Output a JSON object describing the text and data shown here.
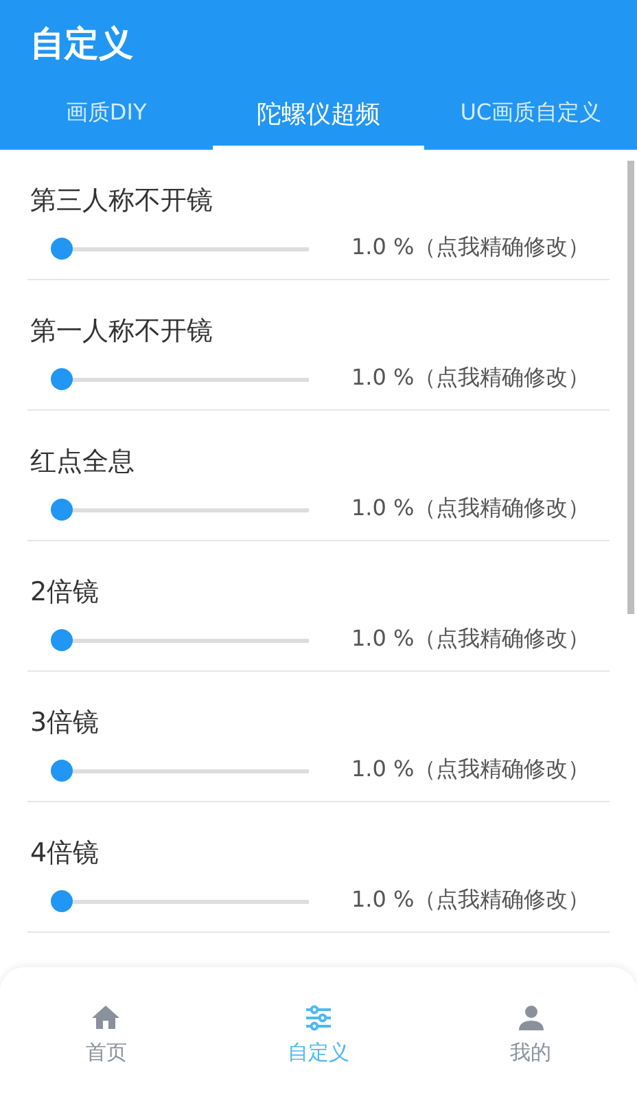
{
  "app_bar": {
    "title": "自定义"
  },
  "tabs": [
    {
      "label": "画质DIY",
      "selected": false
    },
    {
      "label": "陀螺仪超频",
      "selected": true
    },
    {
      "label": "UC画质自定义",
      "selected": false
    }
  ],
  "settings": [
    {
      "name": "第三人称不开镜",
      "level": 0.01,
      "reading": "1.0 %（点我精确修改）"
    },
    {
      "name": "第一人称不开镜",
      "level": 0.01,
      "reading": "1.0 %（点我精确修改）"
    },
    {
      "name": "红点全息",
      "level": 0.01,
      "reading": "1.0 %（点我精确修改）"
    },
    {
      "name": "2倍镜",
      "level": 0.01,
      "reading": "1.0 %（点我精确修改）"
    },
    {
      "name": "3倍镜",
      "level": 0.01,
      "reading": "1.0 %（点我精确修改）"
    },
    {
      "name": "4倍镜",
      "level": 0.01,
      "reading": "1.0 %（点我精确修改）"
    }
  ],
  "bottom_nav": [
    {
      "kind": "home",
      "label": "首页",
      "selected": false
    },
    {
      "kind": "sliders",
      "label": "自定义",
      "selected": true
    },
    {
      "kind": "person",
      "label": "我的",
      "selected": false
    }
  ]
}
